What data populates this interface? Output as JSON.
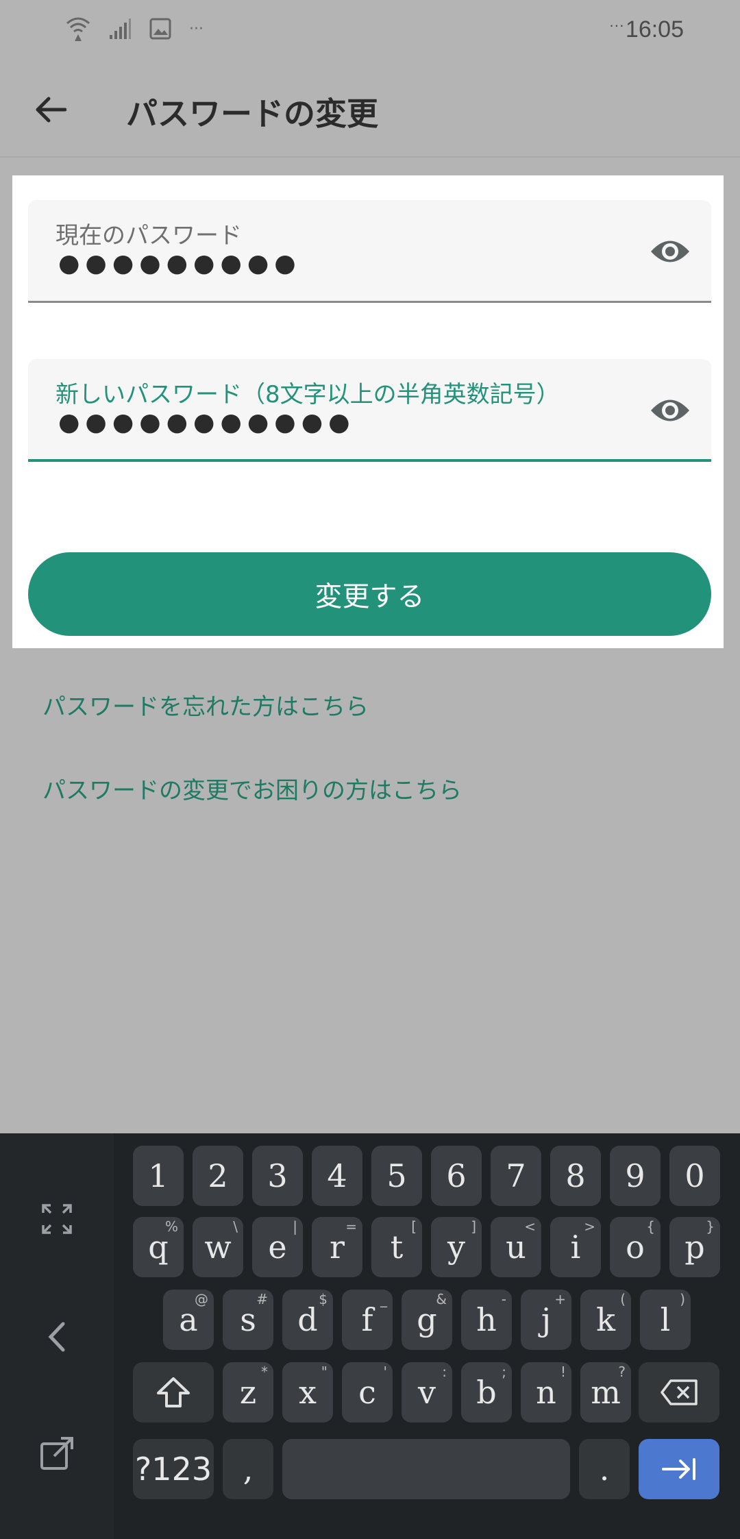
{
  "status_bar": {
    "time": "16:05",
    "left_overflow": "···",
    "time_prefix": "···",
    "icons": [
      "wifi-icon",
      "signal-icon",
      "image-icon"
    ]
  },
  "app_bar": {
    "title": "パスワードの変更",
    "back_icon": "arrow-left-icon"
  },
  "form": {
    "current_password": {
      "label": "現在のパスワード",
      "value": "●●●●●●●●●"
    },
    "new_password": {
      "label": "新しいパスワード（8文字以上の半角英数記号）",
      "value": "●●●●●●●●●●●"
    },
    "submit_label": "変更する"
  },
  "links": {
    "forgot": "パスワードを忘れた方はこちら",
    "trouble": "パスワードの変更でお困りの方はこちら"
  },
  "keyboard": {
    "number_row": [
      "1",
      "2",
      "3",
      "4",
      "5",
      "6",
      "7",
      "8",
      "9",
      "0"
    ],
    "row1": [
      {
        "k": "q",
        "s": "%"
      },
      {
        "k": "w",
        "s": "\\"
      },
      {
        "k": "e",
        "s": "|"
      },
      {
        "k": "r",
        "s": "="
      },
      {
        "k": "t",
        "s": "["
      },
      {
        "k": "y",
        "s": "]"
      },
      {
        "k": "u",
        "s": "<"
      },
      {
        "k": "i",
        "s": ">"
      },
      {
        "k": "o",
        "s": "{"
      },
      {
        "k": "p",
        "s": "}"
      }
    ],
    "row2": [
      {
        "k": "a",
        "s": "@"
      },
      {
        "k": "s",
        "s": "#"
      },
      {
        "k": "d",
        "s": "$"
      },
      {
        "k": "f",
        "s": "_"
      },
      {
        "k": "g",
        "s": "&"
      },
      {
        "k": "h",
        "s": "-"
      },
      {
        "k": "j",
        "s": "+"
      },
      {
        "k": "k",
        "s": "("
      },
      {
        "k": "l",
        "s": ")"
      }
    ],
    "row3": [
      {
        "k": "z",
        "s": "*"
      },
      {
        "k": "x",
        "s": "\""
      },
      {
        "k": "c",
        "s": "'"
      },
      {
        "k": "v",
        "s": ":"
      },
      {
        "k": "b",
        "s": ";"
      },
      {
        "k": "n",
        "s": "!"
      },
      {
        "k": "m",
        "s": "?"
      }
    ],
    "symbols_label": "?123",
    "comma": ",",
    "period": "."
  },
  "colors": {
    "accent": "#23927a",
    "enter_key": "#4c78d0"
  }
}
